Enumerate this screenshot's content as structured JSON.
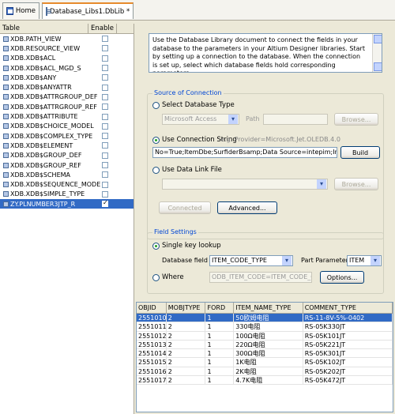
{
  "tabs": [
    {
      "label": "Home",
      "icon": "home-icon"
    },
    {
      "label": "Database_Libs1.DbLib *",
      "icon": "document-icon"
    }
  ],
  "table_panel": {
    "headers": [
      "Table",
      "Enable"
    ],
    "rows": [
      {
        "name": "XDB.PATH_VIEW",
        "enabled": false
      },
      {
        "name": "XDB.RESOURCE_VIEW",
        "enabled": false
      },
      {
        "name": "XDB.XDB$ACL",
        "enabled": false
      },
      {
        "name": "XDB.XDB$ACL_MGD_S",
        "enabled": false
      },
      {
        "name": "XDB.XDB$ANY",
        "enabled": false
      },
      {
        "name": "XDB.XDB$ANYATTR",
        "enabled": false
      },
      {
        "name": "XDB.XDB$ATTRGROUP_DEF",
        "enabled": false
      },
      {
        "name": "XDB.XDB$ATTRGROUP_REF",
        "enabled": false
      },
      {
        "name": "XDB.XDB$ATTRIBUTE",
        "enabled": false
      },
      {
        "name": "XDB.XDB$CHOICE_MODEL",
        "enabled": false
      },
      {
        "name": "XDB.XDB$COMPLEX_TYPE",
        "enabled": false
      },
      {
        "name": "XDB.XDB$ELEMENT",
        "enabled": false
      },
      {
        "name": "XDB.XDB$GROUP_DEF",
        "enabled": false
      },
      {
        "name": "XDB.XDB$GROUP_REF",
        "enabled": false
      },
      {
        "name": "XDB.XDB$SCHEMA",
        "enabled": false
      },
      {
        "name": "XDB.XDB$SEQUENCE_MODEL",
        "enabled": false
      },
      {
        "name": "XDB.XDB$SIMPLE_TYPE",
        "enabled": false
      },
      {
        "name": "ZY.PLNUMBER3JTP_R",
        "enabled": true,
        "selected": true
      }
    ]
  },
  "settings": {
    "description": "Use the Database Library document to connect the fields in your database to the parameters in your Altium Designer libraries. Start by setting up a connection to the database. When the connection is set up, select which database fields hold corresponding parameters.",
    "source_group": "Source of Connection",
    "opt_db_type": "Select Database Type",
    "db_type_value": "Microsoft Access",
    "path_label": "Path",
    "browse_label": "Browse...",
    "opt_conn": "Use Connection String",
    "conn_hint": "e.g. Provider=Microsoft.Jet.OLEDB.4.0",
    "conn_value": "No=True;ItemDbe;SurfiderBsamp;Data Source=intepim;Initial Catalog=3010",
    "build_label": "Build",
    "opt_udl": "Use Data Link File",
    "browse2_label": "Browse...",
    "connected_label": "Connected",
    "advanced_label": "Advanced...",
    "field_group": "Field Settings",
    "opt_single": "Single key lookup",
    "db_field_label": "Database field",
    "db_field_value": "ITEM_CODE_TYPE",
    "part_param_label": "Part Parameter",
    "part_param_value": "ITEM",
    "opt_where": "Where",
    "where_value": "ODB_ITEM_CODE=ITEM_CODE_ONE",
    "options_label": "Options..."
  },
  "grid": {
    "headers": [
      "OBJID",
      "MOBJTYPE",
      "FORD",
      "ITEM_NAME_TYPE",
      "COMMENT_TYPE"
    ],
    "rows": [
      {
        "objid": "2551010",
        "mobjtype": "2",
        "ford": "1",
        "item": "50欧姆电阻",
        "comment": "RS-11-8V-5%-0402",
        "selected": true
      },
      {
        "objid": "2551011",
        "mobjtype": "2",
        "ford": "1",
        "item": "330电阻",
        "comment": "RS-05K330JT"
      },
      {
        "objid": "2551012",
        "mobjtype": "2",
        "ford": "1",
        "item": "100Ω电阻",
        "comment": "RS-05K101JT"
      },
      {
        "objid": "2551013",
        "mobjtype": "2",
        "ford": "1",
        "item": "220Ω电阻",
        "comment": "RS-05K221JT"
      },
      {
        "objid": "2551014",
        "mobjtype": "2",
        "ford": "1",
        "item": "300Ω电阻",
        "comment": "RS-05K301JT"
      },
      {
        "objid": "2551015",
        "mobjtype": "2",
        "ford": "1",
        "item": "1K电阻",
        "comment": "RS-05K102JT"
      },
      {
        "objid": "2551016",
        "mobjtype": "2",
        "ford": "1",
        "item": "2K电阻",
        "comment": "RS-05K202JT"
      },
      {
        "objid": "2551017",
        "mobjtype": "2",
        "ford": "1",
        "item": "4.7K电阻",
        "comment": "RS-05K472JT"
      }
    ]
  }
}
